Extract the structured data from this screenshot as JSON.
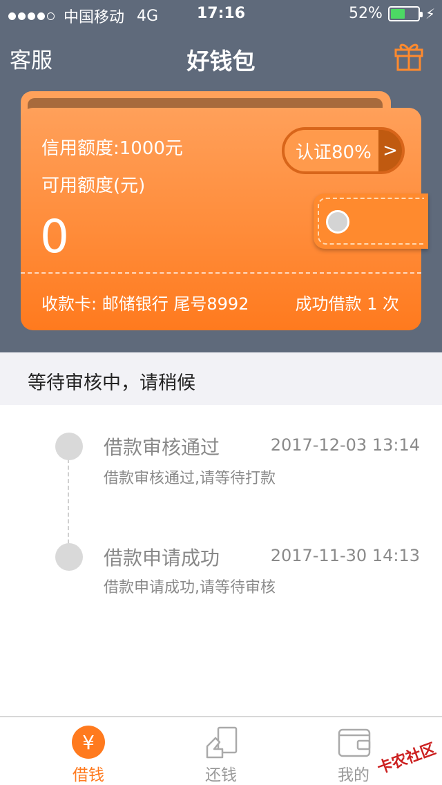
{
  "status_bar": {
    "carrier": "中国移动",
    "network": "4G",
    "time": "17:16",
    "battery": "52%",
    "battery_level": 0.52,
    "battery_color": "#4cd964"
  },
  "nav": {
    "left_label": "客服",
    "title": "好钱包",
    "right_icon": "gift-icon"
  },
  "card": {
    "credit_line": "信用额度:1000元",
    "available_label": "可用额度(元)",
    "available_value": "0",
    "certification": "认证80%",
    "certification_arrow": ">",
    "bank_info": "收款卡: 邮储银行 尾号8992",
    "success_info": "成功借款 1 次"
  },
  "waiting_text": "等待审核中，请稍候",
  "timeline": [
    {
      "title": "借款审核通过",
      "time": "2017-12-03 13:14",
      "desc": "借款审核通过,请等待打款"
    },
    {
      "title": "借款申请成功",
      "time": "2017-11-30 14:13",
      "desc": "借款申请成功,请等待审核"
    }
  ],
  "tabs": [
    {
      "label": "借钱",
      "icon": "yen-icon",
      "active": true
    },
    {
      "label": "还钱",
      "icon": "repay-icon",
      "active": false
    },
    {
      "label": "我的",
      "icon": "wallet-icon",
      "active": false
    }
  ],
  "watermark": "卡农社区",
  "colors": {
    "header_bg": "#5f6a7b",
    "accent": "#ff7a1e"
  }
}
